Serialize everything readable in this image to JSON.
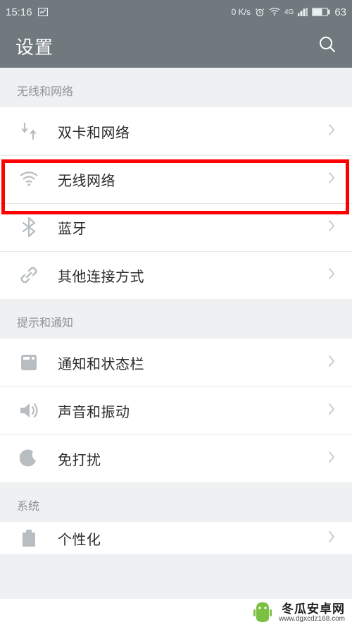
{
  "status": {
    "time": "15:16",
    "net_speed": "0 K/s",
    "network_label": "4G",
    "battery": "63"
  },
  "header": {
    "title": "设置"
  },
  "sections": [
    {
      "title": "无线和网络",
      "items": [
        {
          "icon": "dual-sim-icon",
          "label": "双卡和网络"
        },
        {
          "icon": "wifi-icon",
          "label": "无线网络"
        },
        {
          "icon": "bluetooth-icon",
          "label": "蓝牙"
        },
        {
          "icon": "link-icon",
          "label": "其他连接方式"
        }
      ]
    },
    {
      "title": "提示和通知",
      "items": [
        {
          "icon": "notification-icon",
          "label": "通知和状态栏"
        },
        {
          "icon": "sound-icon",
          "label": "声音和振动"
        },
        {
          "icon": "dnd-icon",
          "label": "免打扰"
        }
      ]
    },
    {
      "title": "系统",
      "items": [
        {
          "icon": "personalize-icon",
          "label": "个性化"
        }
      ]
    }
  ],
  "highlight": {
    "section": 0,
    "item": 1
  },
  "watermark": {
    "cn": "冬瓜安卓网",
    "url": "www.dgxcdz168.com"
  }
}
